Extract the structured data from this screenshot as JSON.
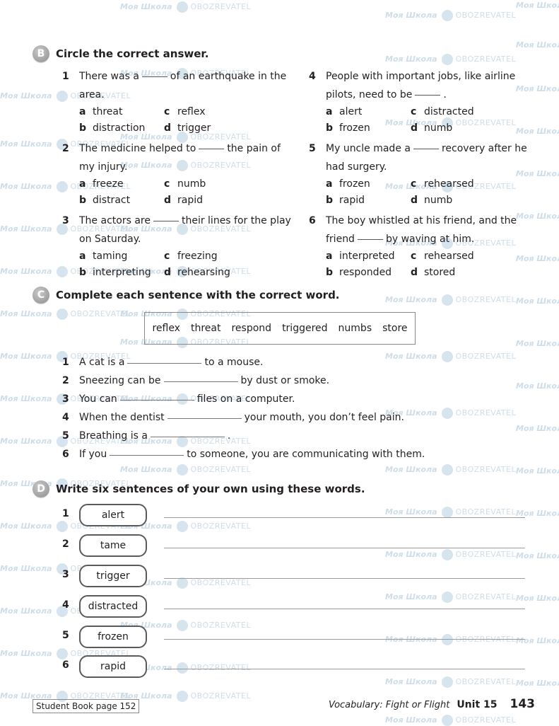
{
  "watermark": {
    "left_text": "Моя Школа",
    "right_text": "OBOZREVATEL"
  },
  "section_b": {
    "badge": "B",
    "title": "Circle the correct answer.",
    "questions": [
      {
        "num": "1",
        "before": "There was a",
        "after": "of an earthquake in the area.",
        "options": [
          {
            "letter": "a",
            "text": "threat"
          },
          {
            "letter": "c",
            "text": "reflex"
          },
          {
            "letter": "b",
            "text": "distraction"
          },
          {
            "letter": "d",
            "text": "trigger"
          }
        ]
      },
      {
        "num": "2",
        "before": "The medicine helped to",
        "after": "the pain of my injury.",
        "options": [
          {
            "letter": "a",
            "text": "freeze"
          },
          {
            "letter": "c",
            "text": "numb"
          },
          {
            "letter": "b",
            "text": "distract"
          },
          {
            "letter": "d",
            "text": "rapid"
          }
        ]
      },
      {
        "num": "3",
        "before": "The actors are",
        "after": "their lines for the play on Saturday.",
        "options": [
          {
            "letter": "a",
            "text": "taming"
          },
          {
            "letter": "c",
            "text": "freezing"
          },
          {
            "letter": "b",
            "text": "interpreting"
          },
          {
            "letter": "d",
            "text": "rehearsing"
          }
        ]
      },
      {
        "num": "4",
        "before": "People with important jobs, like airline pilots, need to be",
        "after": ".",
        "options": [
          {
            "letter": "a",
            "text": "alert"
          },
          {
            "letter": "c",
            "text": "distracted"
          },
          {
            "letter": "b",
            "text": "frozen"
          },
          {
            "letter": "d",
            "text": "numb"
          }
        ]
      },
      {
        "num": "5",
        "before": "My uncle made a",
        "after": "recovery after he had surgery.",
        "options": [
          {
            "letter": "a",
            "text": "frozen"
          },
          {
            "letter": "c",
            "text": "rehearsed"
          },
          {
            "letter": "b",
            "text": "rapid"
          },
          {
            "letter": "d",
            "text": "numb"
          }
        ]
      },
      {
        "num": "6",
        "before": "The boy whistled at his friend, and the friend",
        "after": "by waving at him.",
        "options": [
          {
            "letter": "a",
            "text": "interpreted"
          },
          {
            "letter": "c",
            "text": "rehearsed"
          },
          {
            "letter": "b",
            "text": "responded"
          },
          {
            "letter": "d",
            "text": "stored"
          }
        ]
      }
    ]
  },
  "section_c": {
    "badge": "C",
    "title": "Complete each sentence with the correct word.",
    "word_bank": [
      "reflex",
      "threat",
      "respond",
      "triggered",
      "numbs",
      "store"
    ],
    "sentences": [
      {
        "num": "1",
        "before": "A cat is a",
        "after": "to a mouse."
      },
      {
        "num": "2",
        "before": "Sneezing can be",
        "after": "by dust or smoke."
      },
      {
        "num": "3",
        "before": "You can",
        "after": "files on a computer."
      },
      {
        "num": "4",
        "before": "When the dentist",
        "after": "your mouth, you don’t feel pain."
      },
      {
        "num": "5",
        "before": "Breathing is a",
        "after": "."
      },
      {
        "num": "6",
        "before": "If you",
        "after": "to someone, you are communicating with them."
      }
    ]
  },
  "section_d": {
    "badge": "D",
    "title": "Write six sentences of your own using these words.",
    "items": [
      {
        "num": "1",
        "word": "alert"
      },
      {
        "num": "2",
        "word": "tame"
      },
      {
        "num": "3",
        "word": "trigger"
      },
      {
        "num": "4",
        "word": "distracted"
      },
      {
        "num": "5",
        "word": "frozen"
      },
      {
        "num": "6",
        "word": "rapid"
      }
    ]
  },
  "footer": {
    "reference": "Student Book page 152",
    "vocabulary": "Vocabulary: Fight or Flight",
    "unit": "Unit 15",
    "page_number": "143"
  }
}
